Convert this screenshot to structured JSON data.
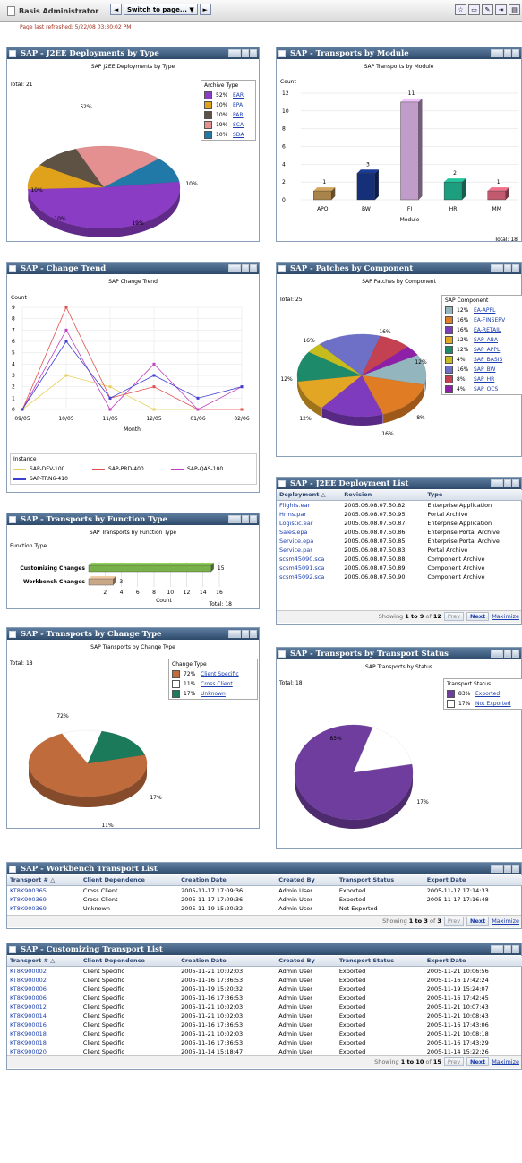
{
  "header": {
    "user": "Basis Administrator",
    "switch_label": "Switch to page...",
    "refreshed": "Page last refreshed: 5/22/08 03:30:02 PM"
  },
  "deploy_type": {
    "title": "SAP - J2EE Deployments by Type",
    "chart_title": "SAP J2EE Deployments by Type",
    "total": "Total: 21",
    "legend_title": "Archive Type",
    "legend": [
      {
        "pct": "52%",
        "name": "EAR",
        "color": "#8a3cc4"
      },
      {
        "pct": "10%",
        "name": "EPA",
        "color": "#e1a21b"
      },
      {
        "pct": "10%",
        "name": "PAR",
        "color": "#5d5244"
      },
      {
        "pct": "19%",
        "name": "SCA",
        "color": "#e59090"
      },
      {
        "pct": "10%",
        "name": "SDA",
        "color": "#2179a8"
      }
    ],
    "slice_labels": [
      "52%",
      "10%",
      "10%",
      "19%",
      "10%"
    ]
  },
  "transports_module": {
    "title": "SAP - Transports by Module",
    "total": "Total: 18"
  },
  "change_trend": {
    "title": "SAP - Change Trend",
    "legend_title": "Instance"
  },
  "patches": {
    "title": "SAP - Patches by Component",
    "chart_title": "SAP Patches by Component",
    "total": "Total: 25",
    "legend_title": "SAP Component",
    "legend": [
      {
        "pct": "12%",
        "name": "EA-APPL",
        "color": "#93b5be"
      },
      {
        "pct": "16%",
        "name": "EA-FINSERV",
        "color": "#e07c24"
      },
      {
        "pct": "16%",
        "name": "EA-RETAIL",
        "color": "#7e3bbd"
      },
      {
        "pct": "12%",
        "name": "SAP_ABA",
        "color": "#e2a524"
      },
      {
        "pct": "12%",
        "name": "SAP_APPL",
        "color": "#1d8a6a"
      },
      {
        "pct": "4%",
        "name": "SAP_BASIS",
        "color": "#c7bc1e"
      },
      {
        "pct": "16%",
        "name": "SAP_BW",
        "color": "#6e70c8"
      },
      {
        "pct": "8%",
        "name": "SAP_HR",
        "color": "#c44152"
      },
      {
        "pct": "4%",
        "name": "SAP_OCS",
        "color": "#8e1fa8"
      }
    ],
    "slice_labels": [
      "16%",
      "16%",
      "12%",
      "12%",
      "8%",
      "16%",
      "12%"
    ]
  },
  "deploy_list": {
    "title": "SAP - J2EE Deployment List",
    "columns": [
      "Deployment △",
      "Revision",
      "Type"
    ],
    "rows": [
      [
        "Flights.ear",
        "2005.06.08.07.50.82",
        "Enterprise Application"
      ],
      [
        "Hrms.par",
        "2005.06.08.07.50.95",
        "Portal Archive"
      ],
      [
        "Logistic.ear",
        "2005.06.08.07.50.87",
        "Enterprise Application"
      ],
      [
        "Sales.epa",
        "2005.06.08.07.50.86",
        "Enterprise Portal Archive"
      ],
      [
        "Service.epa",
        "2005.06.08.07.50.85",
        "Enterprise Portal Archive"
      ],
      [
        "Service.par",
        "2005.06.08.07.50.83",
        "Portal Archive"
      ],
      [
        "scsm45090.sca",
        "2005.06.08.07.50.88",
        "Component Archive"
      ],
      [
        "scsm45091.sca",
        "2005.06.08.07.50.89",
        "Component Archive"
      ],
      [
        "scsm45092.sca",
        "2005.06.08.07.50.90",
        "Component Archive"
      ]
    ],
    "pager": {
      "pre": "Showing",
      "range": "1 to 9",
      "mid": "of",
      "total": "12",
      "prev": "Prev",
      "next": "Next",
      "max": "Maximize"
    }
  },
  "function_type": {
    "title": "SAP - Transports by Function Type",
    "total": "Total: 18"
  },
  "change_type": {
    "title": "SAP - Transports by Change Type",
    "chart_title": "SAP Transports by Change Type",
    "total": "Total: 18",
    "legend_title": "Change Type",
    "legend": [
      {
        "pct": "72%",
        "name": "Client Specific",
        "color": "#c06b3c"
      },
      {
        "pct": "11%",
        "name": "Cross Client",
        "color": "#ffffff"
      },
      {
        "pct": "17%",
        "name": "Unknown",
        "color": "#1b7a5a"
      }
    ],
    "slice_labels": [
      "72%",
      "17%",
      "11%"
    ]
  },
  "transport_status": {
    "title": "SAP - Transports by Transport Status",
    "chart_title": "SAP Transports by Status",
    "total": "Total: 18",
    "legend_title": "Transport Status",
    "legend": [
      {
        "pct": "83%",
        "name": "Exported",
        "color": "#6f3d9e"
      },
      {
        "pct": "17%",
        "name": "Not Exported",
        "color": "#ffffff"
      }
    ],
    "slice_labels": [
      "83%",
      "17%"
    ]
  },
  "workbench": {
    "title": "SAP - Workbench Transport List",
    "columns": [
      "Transport # △",
      "Client Dependence",
      "Creation Date",
      "Created By",
      "Transport Status",
      "Export Date"
    ],
    "rows": [
      [
        "KT8K900365",
        "Cross Client",
        "2005-11-17 17:09:36",
        "Admin User",
        "Exported",
        "2005-11-17 17:14:33"
      ],
      [
        "KT8K900369",
        "Cross Client",
        "2005-11-17 17:09:36",
        "Admin User",
        "Exported",
        "2005-11-17 17:16:48"
      ],
      [
        "KT8K900369",
        "Unknown",
        "2005-11-19 15:20:32",
        "Admin User",
        "Not Exported",
        ""
      ]
    ],
    "pager": {
      "pre": "Showing",
      "range": "1 to 3",
      "mid": "of",
      "total": "3",
      "prev": "Prev",
      "next": "Next",
      "max": "Maximize"
    }
  },
  "customizing": {
    "title": "SAP - Customizing Transport List",
    "columns": [
      "Transport # △",
      "Client Dependence",
      "Creation Date",
      "Created By",
      "Transport Status",
      "Export Date"
    ],
    "rows": [
      [
        "KT8K900002",
        "Client Specific",
        "2005-11-21 10:02:03",
        "Admin User",
        "Exported",
        "2005-11-21 10:06:56"
      ],
      [
        "KT8K900002",
        "Client Specific",
        "2005-11-16 17:36:53",
        "Admin User",
        "Exported",
        "2005-11-16 17:42:24"
      ],
      [
        "KT8K900006",
        "Client Specific",
        "2005-11-19 15:20:32",
        "Admin User",
        "Exported",
        "2005-11-19 15:24:07"
      ],
      [
        "KT8K900006",
        "Client Specific",
        "2005-11-16 17:36:53",
        "Admin User",
        "Exported",
        "2005-11-16 17:42:45"
      ],
      [
        "KT8K900012",
        "Client Specific",
        "2005-11-21 10:02:03",
        "Admin User",
        "Exported",
        "2005-11-21 10:07:43"
      ],
      [
        "KT8K900014",
        "Client Specific",
        "2005-11-21 10:02:03",
        "Admin User",
        "Exported",
        "2005-11-21 10:08:43"
      ],
      [
        "KT8K900016",
        "Client Specific",
        "2005-11-16 17:36:53",
        "Admin User",
        "Exported",
        "2005-11-16 17:43:06"
      ],
      [
        "KT8K900018",
        "Client Specific",
        "2005-11-21 10:02:03",
        "Admin User",
        "Exported",
        "2005-11-21 10:08:18"
      ],
      [
        "KT8K900018",
        "Client Specific",
        "2005-11-16 17:36:53",
        "Admin User",
        "Exported",
        "2005-11-16 17:43:29"
      ],
      [
        "KT8K900020",
        "Client Specific",
        "2005-11-14 15:18:47",
        "Admin User",
        "Exported",
        "2005-11-14 15:22:26"
      ]
    ],
    "pager": {
      "pre": "Showing",
      "range": "1 to 10",
      "mid": "of",
      "total": "15",
      "prev": "Prev",
      "next": "Next",
      "max": "Maximize"
    }
  },
  "chart_data": [
    {
      "type": "pie",
      "title": "SAP J2EE Deployments by Type",
      "legend_title": "Archive Type",
      "labels": [
        "EAR",
        "EPA",
        "PAR",
        "SCA",
        "SDA"
      ],
      "values": [
        52,
        10,
        10,
        19,
        10
      ],
      "total": 21
    },
    {
      "type": "bar",
      "title": "SAP Transports by Module",
      "categories": [
        "APO",
        "BW",
        "FI",
        "HR",
        "MM"
      ],
      "values": [
        1,
        3,
        11,
        2,
        1
      ],
      "xlabel": "Module",
      "ylabel": "Count",
      "ylim": [
        0,
        12
      ],
      "yticks": [
        0,
        2,
        4,
        6,
        8,
        10,
        12
      ],
      "colors": [
        "#a9844a",
        "#152f78",
        "#c09dc9",
        "#1d9e7e",
        "#c15a6e"
      ]
    },
    {
      "type": "line",
      "title": "SAP Change Trend",
      "categories": [
        "09/05",
        "10/05",
        "11/05",
        "12/05",
        "01/06",
        "02/06"
      ],
      "xlabel": "Month",
      "ylabel": "Count",
      "ylim": [
        0,
        9
      ],
      "yticks": [
        0,
        1,
        2,
        3,
        4,
        5,
        6,
        7,
        8,
        9
      ],
      "series": [
        {
          "name": "SAP-DEV-100",
          "color": "#e8d05a",
          "values": [
            0,
            3,
            2,
            0,
            0,
            null
          ]
        },
        {
          "name": "SAP-PRD-400",
          "color": "#e05050",
          "values": [
            0,
            9,
            1,
            2,
            0,
            0
          ]
        },
        {
          "name": "SAP-QAS-100",
          "color": "#c040c0",
          "values": [
            0,
            7,
            0,
            4,
            0,
            2
          ]
        },
        {
          "name": "SAP-TRN6-410",
          "color": "#4040d0",
          "values": [
            0,
            6,
            1,
            3,
            1,
            2
          ]
        }
      ]
    },
    {
      "type": "pie",
      "title": "SAP Patches by Component",
      "legend_title": "SAP Component",
      "labels": [
        "EA-APPL",
        "EA-FINSERV",
        "EA-RETAIL",
        "SAP_ABA",
        "SAP_APPL",
        "SAP_BASIS",
        "SAP_BW",
        "SAP_HR",
        "SAP_OCS"
      ],
      "values": [
        12,
        16,
        16,
        12,
        12,
        4,
        16,
        8,
        4
      ],
      "total": 25
    },
    {
      "type": "bar",
      "orientation": "horizontal",
      "title": "SAP Transports by Function Type",
      "ylabel": "Function Type",
      "xlabel": "Count",
      "categories": [
        "Customizing Changes",
        "Workbench Changes"
      ],
      "values": [
        15,
        3
      ],
      "xticks": [
        2,
        4,
        6,
        8,
        10,
        12,
        14,
        16
      ],
      "colors": [
        "#78b04a",
        "#c9a888"
      ]
    },
    {
      "type": "pie",
      "title": "SAP Transports by Change Type",
      "legend_title": "Change Type",
      "labels": [
        "Client Specific",
        "Cross Client",
        "Unknown"
      ],
      "values": [
        72,
        11,
        17
      ],
      "total": 18
    },
    {
      "type": "pie",
      "title": "SAP Transports by Status",
      "legend_title": "Transport Status",
      "labels": [
        "Exported",
        "Not Exported"
      ],
      "values": [
        83,
        17
      ],
      "total": 18
    }
  ]
}
